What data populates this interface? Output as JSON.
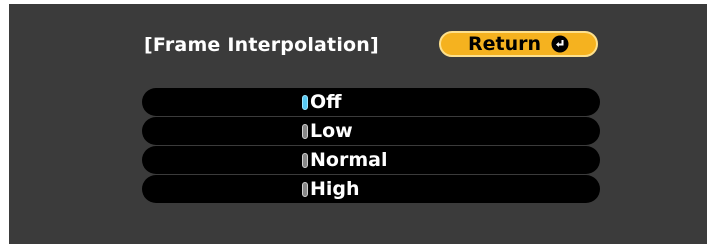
{
  "menu": {
    "title": "[Frame Interpolation]",
    "return_button": {
      "label": "Return",
      "icon": "enter-icon"
    },
    "options": [
      {
        "label": "Off",
        "selected": true
      },
      {
        "label": "Low",
        "selected": false
      },
      {
        "label": "Normal",
        "selected": false
      },
      {
        "label": "High",
        "selected": false
      }
    ]
  },
  "colors": {
    "background": "#3b3b3b",
    "accent_button": "#f5b21f",
    "option_row": "#000000",
    "selected_indicator": "#58c9f2"
  }
}
